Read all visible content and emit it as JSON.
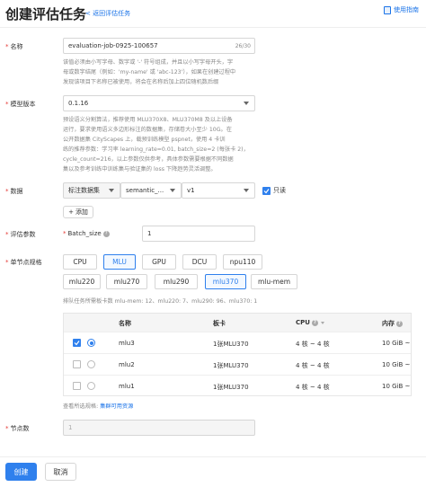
{
  "header": {
    "title": "创建评估任务",
    "back_label": "返回评估任务",
    "guide_label": "使用指南"
  },
  "form": {
    "name": {
      "label": "名称",
      "value": "evaluation-job-0925-100657",
      "counter": "26/30",
      "help": [
        "该值必须由小写字母、数字或 '-' 符号组成，并且以小写字母开头，字",
        "母或数字结尾（例如：'my-name' 或 'abc-123'），如果在创建过程中",
        "发现该项目下名称已被使用，将会在名称后加上四位随机数后缀"
      ]
    },
    "model_version": {
      "label": "模型版本",
      "value": "0.1.16",
      "help": [
        "预设语义分割算法，推荐使用 MLU370X8、MLU370M8 及以上设备",
        "运行，要求使用语义多边形标注的数据集，存储卷大小至少 10G。在",
        "公开数据集 CityScapes 上，载预训练模型 pspnet，使用 4 卡训",
        "练的推荐参数：学习率 learning_rate=0.01, batch_size=2 (每张卡 2)，",
        "cycle_count=216，以上参数仅供参考，具体参数需要根据不同数据",
        "集以及参考训练中训练集与验证集的 loss 下降趋势灵活调整。"
      ]
    },
    "data": {
      "label": "数据",
      "type_value": "标注数据集",
      "dataset_value": "semantic_...",
      "version_value": "v1",
      "readonly_label": "只读",
      "add_label": "添加"
    },
    "eval_params": {
      "label": "评估参数",
      "batch_label": "Batch_size",
      "batch_value": "1"
    },
    "node_spec": {
      "label": "单节点规格",
      "chips_row1": [
        "CPU",
        "MLU",
        "GPU",
        "DCU",
        "npu110"
      ],
      "chips_row2": [
        "mlu220",
        "mlu270",
        "mlu290",
        "mlu370",
        "mlu-mem"
      ],
      "queue_info": "排队任务所需板卡数 mlu-mem: 12、mlu220: 7、mlu290: 96、mlu370: 1",
      "table": {
        "headers": [
          "名称",
          "板卡",
          "CPU",
          "内存"
        ],
        "rows": [
          {
            "name": "mlu3",
            "card": "1张MLU370",
            "cpu": "4 核 ~ 4 核",
            "mem": "10 GiB ~"
          },
          {
            "name": "mlu2",
            "card": "1张MLU370",
            "cpu": "4 核 ~ 4 核",
            "mem": "10 GiB ~"
          },
          {
            "name": "mlu1",
            "card": "1张MLU370",
            "cpu": "4 核 ~ 4 核",
            "mem": "10 GiB ~"
          }
        ]
      },
      "footer_prefix": "查看所选规格: ",
      "footer_link": "集群可用资源"
    },
    "node_count": {
      "label": "节点数",
      "value": "1"
    }
  },
  "actions": {
    "create_label": "创建",
    "cancel_label": "取消"
  },
  "colors": {
    "primary": "#2f80ed",
    "required": "#e53935"
  }
}
